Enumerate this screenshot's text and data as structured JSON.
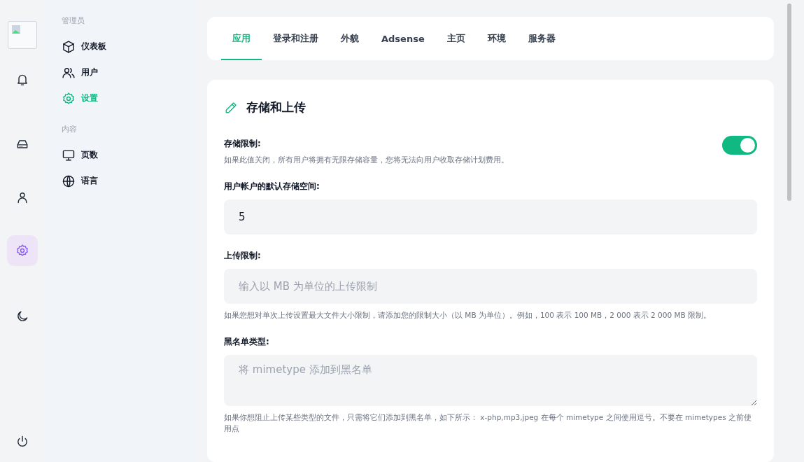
{
  "rail": {
    "items": [
      {
        "selected": false
      },
      {
        "selected": false
      },
      {
        "selected": false
      },
      {
        "selected": true
      },
      {
        "selected": false
      }
    ]
  },
  "nav": {
    "sections": [
      {
        "heading": "管理员",
        "items": [
          {
            "label": "仪表板",
            "selected": false
          },
          {
            "label": "用户",
            "selected": false
          },
          {
            "label": "设置",
            "selected": true
          }
        ]
      },
      {
        "heading": "内容",
        "items": [
          {
            "label": "页数",
            "selected": false
          },
          {
            "label": "语言",
            "selected": false
          }
        ]
      }
    ]
  },
  "tabs": [
    {
      "label": "应用",
      "selected": true
    },
    {
      "label": "登录和注册",
      "selected": false
    },
    {
      "label": "外貌",
      "selected": false
    },
    {
      "label": "Adsense",
      "selected": false
    },
    {
      "label": "主页",
      "selected": false
    },
    {
      "label": "环境",
      "selected": false
    },
    {
      "label": "服务器",
      "selected": false
    }
  ],
  "card": {
    "title": "存储和上传",
    "fields": [
      {
        "kind": "toggle",
        "label": "存储限制:",
        "help": "如果此值关闭，所有用户将拥有无限存储容量，您将无法向用户收取存储计划费用。",
        "on": true
      },
      {
        "kind": "input",
        "label": "用户帐户的默认存储空间:",
        "value": "5"
      },
      {
        "kind": "input",
        "label": "上传限制:",
        "placeholder": "输入以 MB 为单位的上传限制",
        "help": "如果您想对单次上传设置最大文件大小限制，请添加您的限制大小（以 MB 为单位）。例如，100 表示 100 MB，2 000 表示 2 000 MB 限制。"
      },
      {
        "kind": "textarea",
        "label": "黑名单类型:",
        "placeholder": "将 mimetype 添加到黑名单",
        "help": "如果你想阻止上传某些类型的文件，只需将它们添加到黑名单，如下所示： x-php,mp3,jpeg 在每个 mimetype 之间使用逗号。不要在 mimetypes 之前使用点"
      }
    ]
  }
}
